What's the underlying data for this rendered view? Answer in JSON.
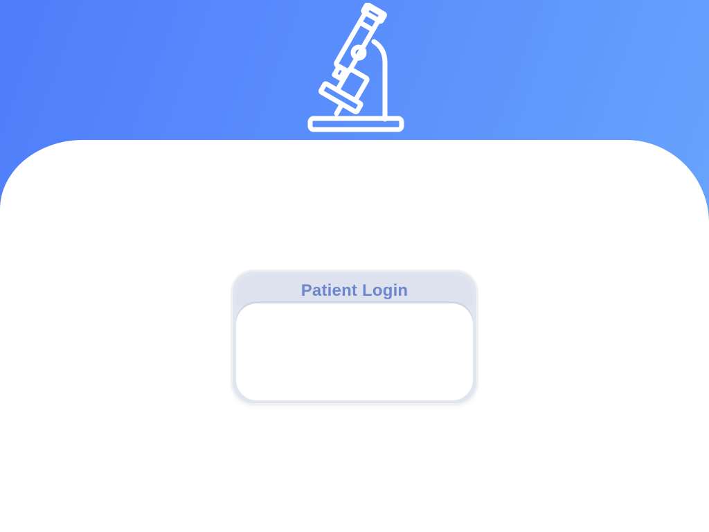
{
  "header": {
    "logo_icon": "microscope-icon",
    "gradient_start": "#4f7dfb",
    "gradient_end": "#68a3fd"
  },
  "login_card": {
    "title": "Patient Login",
    "title_color": "#6e87cc"
  }
}
